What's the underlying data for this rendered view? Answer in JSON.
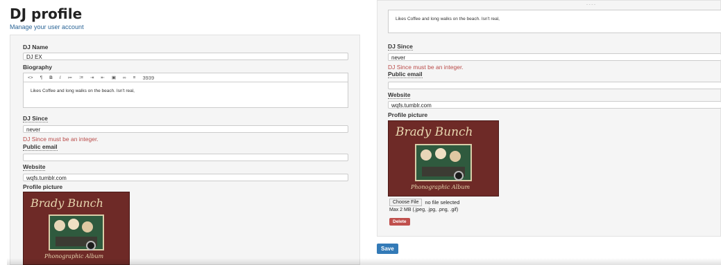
{
  "page": {
    "title": "DJ profile",
    "subtitle": "Manage your user account"
  },
  "left": {
    "dj_name_label": "DJ Name",
    "dj_name_value": "DJ EX",
    "biography_label": "Biography",
    "toolbar_items": [
      "<>",
      "¶",
      "B",
      "I",
      "≔",
      "⁝≡",
      "⇥",
      "⇤",
      "▣",
      "∞",
      "≡",
      "3939"
    ],
    "biography_text": "Likes Coffee and long walks on the beach. Isn't real,",
    "dj_since_label": "DJ Since",
    "dj_since_value": "never",
    "dj_since_error": "DJ Since must be an integer.",
    "public_email_label": "Public email",
    "public_email_value": "",
    "website_label": "Website",
    "website_value": "wqfs.tumblr.com",
    "profile_picture_label": "Profile picture"
  },
  "right": {
    "top_hint": "- - - -",
    "biography_text": "Likes Coffee and long walks on the beach. Isn't real,",
    "dj_since_label": "DJ Since",
    "dj_since_value": "never",
    "dj_since_error": "DJ Since must be an integer.",
    "public_email_label": "Public email",
    "public_email_value": "",
    "website_label": "Website",
    "website_value": "wqfs.tumblr.com",
    "profile_picture_label": "Profile picture",
    "choose_file_label": "Choose File",
    "no_file_text": "no file selected",
    "max_size_text": "Max 2 MB (.jpeg, .jpg, .png, .gif)",
    "delete_label": "Delete",
    "save_label": "Save"
  },
  "album": {
    "title_top": "Brady Bunch",
    "title_bottom": "Phonographic Album"
  },
  "colors": {
    "error": "#b94a48",
    "link": "#2a6496",
    "save": "#337ab7",
    "delete": "#c0504d"
  }
}
